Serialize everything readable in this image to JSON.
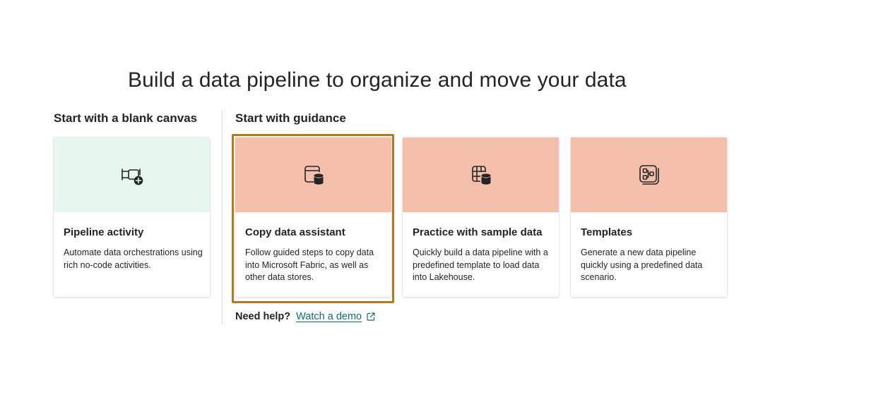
{
  "page": {
    "title": "Build a data pipeline to organize and move your data"
  },
  "sections": {
    "blank": {
      "title": "Start with a blank canvas"
    },
    "guidance": {
      "title": "Start with guidance"
    }
  },
  "cards": [
    {
      "title": "Pipeline activity",
      "description": "Automate data orchestrations using rich no-code activities.",
      "icon": "pipeline-add-icon",
      "banner_color": "#e5f7ee"
    },
    {
      "title": "Copy data assistant",
      "description": "Follow guided steps to copy data into Microsoft Fabric, as well as other data stores.",
      "icon": "copy-data-icon",
      "banner_color": "#f5c0ab",
      "selected": true
    },
    {
      "title": "Practice with sample data",
      "description": "Quickly build a data pipeline with a predefined template to load data into Lakehouse.",
      "icon": "sample-data-icon",
      "banner_color": "#f5c0ab"
    },
    {
      "title": "Templates",
      "description": "Generate a new data pipeline quickly using a predefined data scenario.",
      "icon": "templates-icon",
      "banner_color": "#f5c0ab"
    }
  ],
  "help": {
    "label": "Need help?",
    "link_text": "Watch a demo",
    "link_icon": "external-link-icon"
  },
  "colors": {
    "selection_outline": "#b07a1e",
    "link": "#0f6c6c",
    "text": "#242424"
  }
}
